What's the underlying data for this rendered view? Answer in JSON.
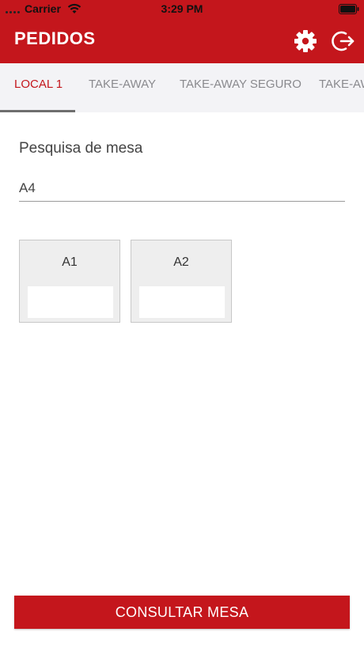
{
  "status_bar": {
    "carrier": "Carrier",
    "time": "3:29 PM",
    "icons": [
      "signal-dots-icon",
      "wifi-icon",
      "battery-icon"
    ]
  },
  "header": {
    "title": "PEDIDOS",
    "icons": [
      "gear-icon",
      "logout-icon"
    ],
    "color": "#c4161c"
  },
  "tabs": [
    {
      "label": "LOCAL 1",
      "active": true
    },
    {
      "label": "TAKE-AWAY",
      "active": false
    },
    {
      "label": "TAKE-AWAY SEGURO",
      "active": false
    },
    {
      "label": "TAKE-AWAY",
      "active": false
    }
  ],
  "search": {
    "label": "Pesquisa de mesa",
    "value": "A4"
  },
  "tables": [
    {
      "name": "A1"
    },
    {
      "name": "A2"
    }
  ],
  "footer": {
    "button_label": "CONSULTAR MESA"
  },
  "colors": {
    "accent": "#c4161c",
    "tab_bar": "#f3f3f6",
    "card": "#eeeeee"
  }
}
